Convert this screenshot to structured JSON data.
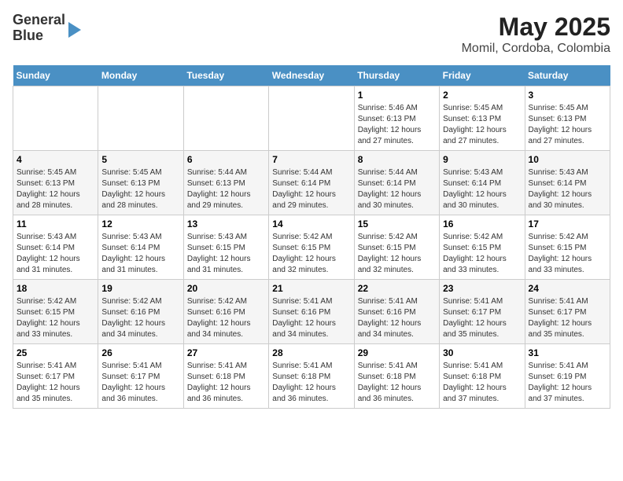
{
  "logo": {
    "line1": "General",
    "line2": "Blue"
  },
  "title": "May 2025",
  "subtitle": "Momil, Cordoba, Colombia",
  "days_of_week": [
    "Sunday",
    "Monday",
    "Tuesday",
    "Wednesday",
    "Thursday",
    "Friday",
    "Saturday"
  ],
  "weeks": [
    [
      {
        "num": "",
        "info": ""
      },
      {
        "num": "",
        "info": ""
      },
      {
        "num": "",
        "info": ""
      },
      {
        "num": "",
        "info": ""
      },
      {
        "num": "1",
        "info": "Sunrise: 5:46 AM\nSunset: 6:13 PM\nDaylight: 12 hours and 27 minutes."
      },
      {
        "num": "2",
        "info": "Sunrise: 5:45 AM\nSunset: 6:13 PM\nDaylight: 12 hours and 27 minutes."
      },
      {
        "num": "3",
        "info": "Sunrise: 5:45 AM\nSunset: 6:13 PM\nDaylight: 12 hours and 27 minutes."
      }
    ],
    [
      {
        "num": "4",
        "info": "Sunrise: 5:45 AM\nSunset: 6:13 PM\nDaylight: 12 hours and 28 minutes."
      },
      {
        "num": "5",
        "info": "Sunrise: 5:45 AM\nSunset: 6:13 PM\nDaylight: 12 hours and 28 minutes."
      },
      {
        "num": "6",
        "info": "Sunrise: 5:44 AM\nSunset: 6:13 PM\nDaylight: 12 hours and 29 minutes."
      },
      {
        "num": "7",
        "info": "Sunrise: 5:44 AM\nSunset: 6:14 PM\nDaylight: 12 hours and 29 minutes."
      },
      {
        "num": "8",
        "info": "Sunrise: 5:44 AM\nSunset: 6:14 PM\nDaylight: 12 hours and 30 minutes."
      },
      {
        "num": "9",
        "info": "Sunrise: 5:43 AM\nSunset: 6:14 PM\nDaylight: 12 hours and 30 minutes."
      },
      {
        "num": "10",
        "info": "Sunrise: 5:43 AM\nSunset: 6:14 PM\nDaylight: 12 hours and 30 minutes."
      }
    ],
    [
      {
        "num": "11",
        "info": "Sunrise: 5:43 AM\nSunset: 6:14 PM\nDaylight: 12 hours and 31 minutes."
      },
      {
        "num": "12",
        "info": "Sunrise: 5:43 AM\nSunset: 6:14 PM\nDaylight: 12 hours and 31 minutes."
      },
      {
        "num": "13",
        "info": "Sunrise: 5:43 AM\nSunset: 6:15 PM\nDaylight: 12 hours and 31 minutes."
      },
      {
        "num": "14",
        "info": "Sunrise: 5:42 AM\nSunset: 6:15 PM\nDaylight: 12 hours and 32 minutes."
      },
      {
        "num": "15",
        "info": "Sunrise: 5:42 AM\nSunset: 6:15 PM\nDaylight: 12 hours and 32 minutes."
      },
      {
        "num": "16",
        "info": "Sunrise: 5:42 AM\nSunset: 6:15 PM\nDaylight: 12 hours and 33 minutes."
      },
      {
        "num": "17",
        "info": "Sunrise: 5:42 AM\nSunset: 6:15 PM\nDaylight: 12 hours and 33 minutes."
      }
    ],
    [
      {
        "num": "18",
        "info": "Sunrise: 5:42 AM\nSunset: 6:15 PM\nDaylight: 12 hours and 33 minutes."
      },
      {
        "num": "19",
        "info": "Sunrise: 5:42 AM\nSunset: 6:16 PM\nDaylight: 12 hours and 34 minutes."
      },
      {
        "num": "20",
        "info": "Sunrise: 5:42 AM\nSunset: 6:16 PM\nDaylight: 12 hours and 34 minutes."
      },
      {
        "num": "21",
        "info": "Sunrise: 5:41 AM\nSunset: 6:16 PM\nDaylight: 12 hours and 34 minutes."
      },
      {
        "num": "22",
        "info": "Sunrise: 5:41 AM\nSunset: 6:16 PM\nDaylight: 12 hours and 34 minutes."
      },
      {
        "num": "23",
        "info": "Sunrise: 5:41 AM\nSunset: 6:17 PM\nDaylight: 12 hours and 35 minutes."
      },
      {
        "num": "24",
        "info": "Sunrise: 5:41 AM\nSunset: 6:17 PM\nDaylight: 12 hours and 35 minutes."
      }
    ],
    [
      {
        "num": "25",
        "info": "Sunrise: 5:41 AM\nSunset: 6:17 PM\nDaylight: 12 hours and 35 minutes."
      },
      {
        "num": "26",
        "info": "Sunrise: 5:41 AM\nSunset: 6:17 PM\nDaylight: 12 hours and 36 minutes."
      },
      {
        "num": "27",
        "info": "Sunrise: 5:41 AM\nSunset: 6:18 PM\nDaylight: 12 hours and 36 minutes."
      },
      {
        "num": "28",
        "info": "Sunrise: 5:41 AM\nSunset: 6:18 PM\nDaylight: 12 hours and 36 minutes."
      },
      {
        "num": "29",
        "info": "Sunrise: 5:41 AM\nSunset: 6:18 PM\nDaylight: 12 hours and 36 minutes."
      },
      {
        "num": "30",
        "info": "Sunrise: 5:41 AM\nSunset: 6:18 PM\nDaylight: 12 hours and 37 minutes."
      },
      {
        "num": "31",
        "info": "Sunrise: 5:41 AM\nSunset: 6:19 PM\nDaylight: 12 hours and 37 minutes."
      }
    ]
  ]
}
